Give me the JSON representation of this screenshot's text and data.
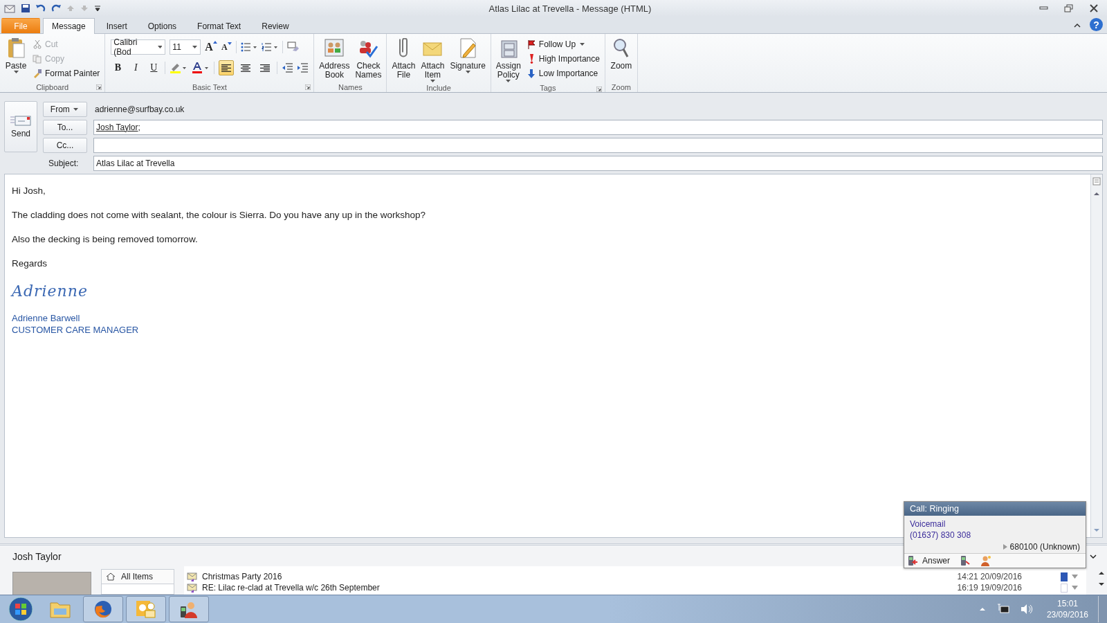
{
  "window": {
    "title": "Atlas Lilac at Trevella  -  Message (HTML)"
  },
  "tabs": [
    {
      "label": "File",
      "kind": "file",
      "selected": false
    },
    {
      "label": "Message",
      "kind": "tab",
      "selected": true
    },
    {
      "label": "Insert",
      "kind": "tab",
      "selected": false
    },
    {
      "label": "Options",
      "kind": "tab",
      "selected": false
    },
    {
      "label": "Format Text",
      "kind": "tab",
      "selected": false
    },
    {
      "label": "Review",
      "kind": "tab",
      "selected": false
    }
  ],
  "ribbon": {
    "groups": [
      {
        "label": "Clipboard",
        "kind": "buttons",
        "large": [
          {
            "label": "Paste",
            "dropdown": true
          }
        ],
        "small": [
          {
            "label": "Cut",
            "disabled": true,
            "dropdown": false
          },
          {
            "label": "Copy",
            "disabled": true,
            "dropdown": false
          },
          {
            "label": "Format Painter",
            "disabled": false,
            "dropdown": false
          }
        ]
      },
      {
        "label": "Basic Text",
        "kind": "text",
        "font": "Calibri (Bod",
        "size": "11",
        "grow": "A",
        "shrink": "A",
        "bold": "B",
        "italic": "I",
        "underline": "U",
        "alignments": [
          {
            "selected": true
          },
          {
            "selected": false
          },
          {
            "selected": false
          }
        ]
      },
      {
        "label": "Names",
        "kind": "buttons",
        "large": [
          {
            "label": "Address Book",
            "dropdown": false
          },
          {
            "label": "Check Names",
            "dropdown": false
          }
        ]
      },
      {
        "label": "Include",
        "kind": "buttons",
        "large": [
          {
            "label": "Attach File",
            "dropdown": false
          },
          {
            "label": "Attach Item",
            "dropdown": true
          },
          {
            "label": "Signature",
            "dropdown": true
          }
        ]
      },
      {
        "label": "Tags",
        "kind": "buttons",
        "large": [
          {
            "label": "Assign Policy",
            "dropdown": true
          }
        ],
        "small": [
          {
            "label": "Follow Up",
            "disabled": false,
            "dropdown": true
          },
          {
            "label": "High Importance",
            "disabled": false,
            "dropdown": false
          },
          {
            "label": "Low Importance",
            "disabled": false,
            "dropdown": false
          }
        ]
      },
      {
        "label": "Zoom",
        "kind": "buttons",
        "large": [
          {
            "label": "Zoom",
            "dropdown": false
          }
        ]
      }
    ],
    "help": "?"
  },
  "send": {
    "label": "Send"
  },
  "fields": [
    {
      "label": "From",
      "kind": "from",
      "value": "adrienne@surfbay.co.uk"
    },
    {
      "label": "To...",
      "kind": "input",
      "value": "Josh Taylor",
      "suffix": ";"
    },
    {
      "label": "Cc...",
      "kind": "input"
    },
    {
      "label": "Subject:",
      "kind": "subject",
      "value": "Atlas Lilac at Trevella"
    }
  ],
  "body": {
    "paragraphs": [
      "Hi Josh,",
      "The cladding does not come with sealant, the colour is Sierra.  Do you have any up in the workshop?",
      "Also the decking is being removed tomorrow.",
      "Regards"
    ],
    "signature_script": "Adrienne",
    "signature_name": "Adrienne Barwell",
    "signature_title": "CUSTOMER CARE MANAGER"
  },
  "people_pane": {
    "name": "Josh Taylor",
    "nav": [
      {
        "label": "All Items",
        "selected": true
      }
    ],
    "items": [
      {
        "subject": "Christmas Party 2016",
        "time": "14:21  20/09/2016",
        "flagged": true
      },
      {
        "subject": "RE: Lilac re-clad at Trevella w/c 26th September",
        "time": "16:19  19/09/2016",
        "flagged": false
      }
    ]
  },
  "call_popup": {
    "title": "Call: Ringing",
    "caller": "Voicemail",
    "number": "(01637) 830 308",
    "extension": "680100  (Unknown)",
    "answer": "Answer"
  },
  "taskbar": {
    "time": "15:01",
    "date": "23/09/2016"
  }
}
